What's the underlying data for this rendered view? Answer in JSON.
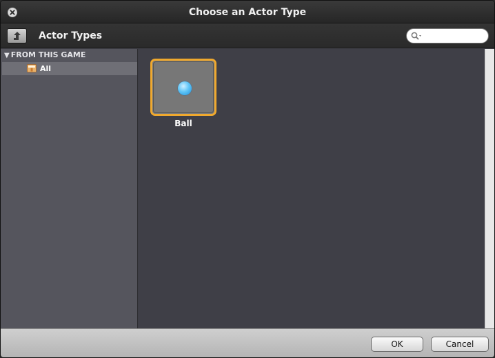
{
  "window": {
    "title": "Choose an Actor Type"
  },
  "toolbar": {
    "title": "Actor Types",
    "search_placeholder": "",
    "icons": [
      "up-arrow-icon",
      "search-icon"
    ]
  },
  "sidebar": {
    "section_header": "FROM THIS GAME",
    "section_expanded": true,
    "items": [
      {
        "label": "All",
        "icon": "folder-icon",
        "selected": true
      }
    ]
  },
  "grid": {
    "items": [
      {
        "label": "Ball",
        "icon": "ball-sprite",
        "selected": true
      }
    ]
  },
  "footer": {
    "ok_label": "OK",
    "cancel_label": "Cancel"
  },
  "colors": {
    "selection_border": "#f0a92e",
    "main_background": "#3f3f47",
    "sidebar_background": "#55555d"
  }
}
